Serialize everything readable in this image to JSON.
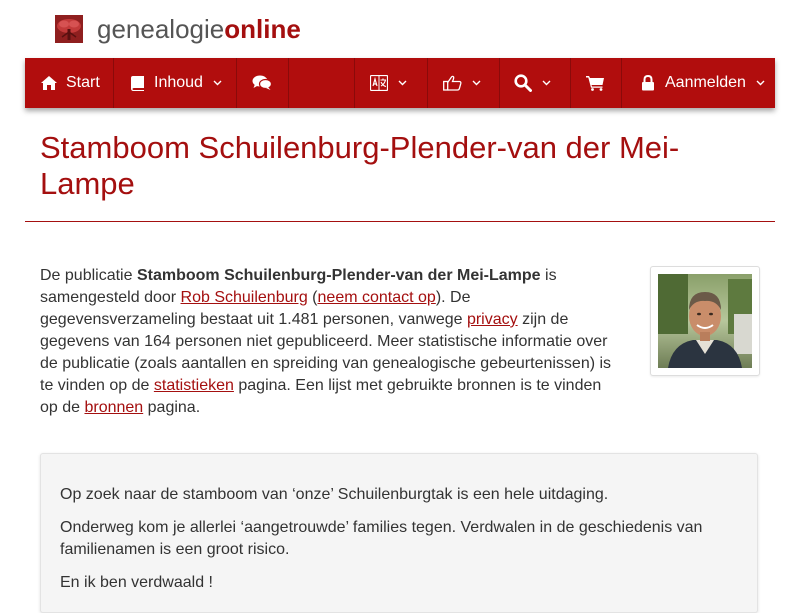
{
  "brand": {
    "part1": "genealogie",
    "part2": "online",
    "logo_icon": "tree-icon",
    "accent_color": "#a40f0f",
    "nav_color": "#b10d0d"
  },
  "nav": {
    "start_label": "Start",
    "inhoud_label": "Inhoud",
    "aanmelden_label": "Aanmelden",
    "icons": [
      "home-icon",
      "book-icon",
      "chevron-down-icon",
      "comments-icon",
      "language-icon",
      "thumbs-up-icon",
      "search-icon",
      "shopping-cart-icon",
      "lock-icon"
    ]
  },
  "page": {
    "title": "Stamboom Schuilenburg-Plender-van der Mei-Lampe"
  },
  "intro": {
    "t1": "De publicatie ",
    "pub_name": "Stamboom Schuilenburg-Plender-van der Mei-Lampe",
    "t2": " is samengesteld door ",
    "author": "Rob Schuilenburg",
    "t3": " (",
    "contact": "neem contact op",
    "t4": "). De gegevensverzameling bestaat uit 1.481 personen, vanwege ",
    "privacy": "privacy",
    "t5": " zijn de gegevens van 164 personen niet gepubliceerd. Meer statistische informatie over de publicatie (zoals aantallen en spreiding van genealogische gebeurtenissen) is te vinden op de ",
    "statistieken": "statistieken",
    "t6": " pagina. Een lijst met gebruikte bronnen is te vinden op de ",
    "bronnen": "bronnen",
    "t7": " pagina."
  },
  "description": {
    "p1": "Op zoek naar de stamboom van ‘onze’ Schuilenburgtak is een hele uitdaging.",
    "p2": "Onderweg kom je allerlei ‘aangetrouwde’ families tegen. Verdwalen in de geschiedenis van familienamen is een groot risico.",
    "p3": "En ik ben verdwaald !"
  }
}
